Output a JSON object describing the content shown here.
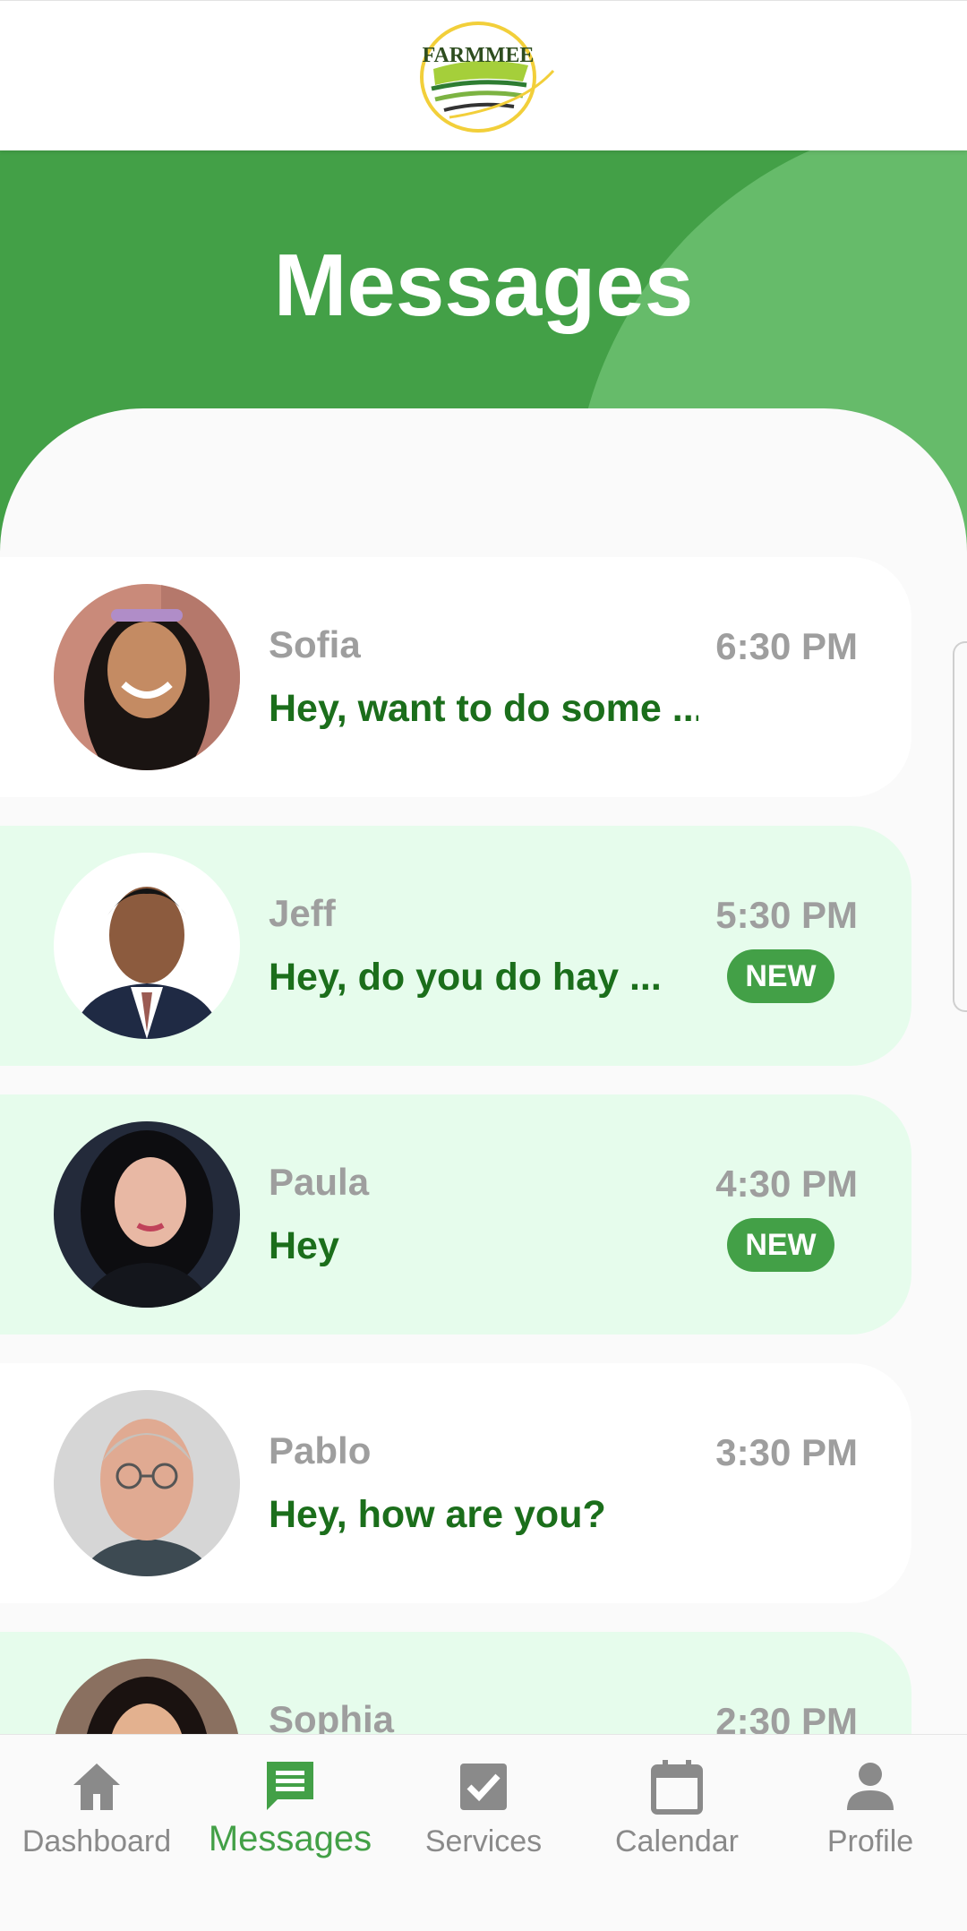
{
  "header": {
    "logo_text": "FARMMEE"
  },
  "hero": {
    "title": "Messages"
  },
  "messages": [
    {
      "name": "Sofia",
      "time": "6:30 PM",
      "preview": "Hey, want to do some ...",
      "badge": ""
    },
    {
      "name": "Jeff",
      "time": "5:30 PM",
      "preview": "Hey, do you do hay ...",
      "badge": "NEW"
    },
    {
      "name": "Paula",
      "time": "4:30 PM",
      "preview": "Hey",
      "badge": "NEW"
    },
    {
      "name": "Pablo",
      "time": "3:30 PM",
      "preview": "Hey, how are you?",
      "badge": ""
    },
    {
      "name": "Sophia",
      "time": "2:30 PM",
      "preview": "",
      "badge": ""
    }
  ],
  "nav": {
    "items": [
      {
        "label": "Dashboard",
        "icon": "home-icon"
      },
      {
        "label": "Messages",
        "icon": "message-icon"
      },
      {
        "label": "Services",
        "icon": "checkbox-icon"
      },
      {
        "label": "Calendar",
        "icon": "calendar-icon"
      },
      {
        "label": "Profile",
        "icon": "person-icon"
      }
    ],
    "active": "Messages"
  },
  "colors": {
    "brand_green": "#43a047",
    "light_green": "#66bb6a",
    "unread_bg": "#e6fcec",
    "preview_text": "#1b6e1b",
    "muted_text": "#9e9e9e",
    "accent_yellow": "#cddc00"
  }
}
